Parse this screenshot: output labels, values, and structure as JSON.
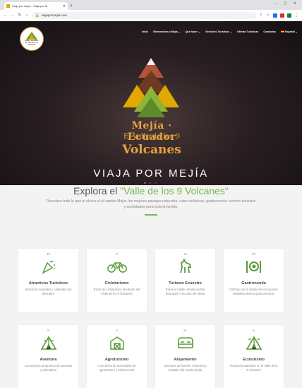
{
  "browser": {
    "tab_title": "Viaja por mejía - Viaja por M",
    "url": "viajapormejia.com"
  },
  "logo": {
    "line1": "Mejía · Ecuador",
    "line2": "El valle de los 9",
    "line3": "Volcanes"
  },
  "nav": {
    "items": [
      "Inicio",
      "Bienvenidos a Mejía ⌄",
      "Qué hacer ⌄",
      "Servicios Turísticos ⌄",
      "Ofertas Turísticas",
      "Contactos",
      "Español ⌄"
    ]
  },
  "hero": {
    "brand_line1": "Mejía · Ecuador",
    "brand_line2": "El valle de los 9",
    "brand_line3": "Volcanes",
    "slogan": "VIAJA POR MEJÍA"
  },
  "explore": {
    "title_prefix": "Explora el ",
    "title_highlight": "\"Valle de los 9 Volcanes\"",
    "subtitle": "Descubre todo lo que te ofrece el el cantón Mejía: los mejores paisajes naturales, rutas ciclísticas, gastronomía, turismo ecuestre y actividades para toda la familia."
  },
  "cards": [
    {
      "count": "40",
      "title": "Atractivos Turísticos",
      "desc": "Atractivos naturales y culturales por descubrir",
      "icon": "party-icon"
    },
    {
      "count": "3",
      "title": "Cicloturismo",
      "desc": "Rutas de cicloturismo alrededor del \"Valle de los 9 Volcanes\"",
      "icon": "bicycle-icon"
    },
    {
      "count": "14",
      "title": "Turismo Ecuestre",
      "desc": "Rutas a caballo donde podrás descubrir el encanto de Mejía",
      "icon": "horse-icon"
    },
    {
      "count": "22",
      "title": "Gastronomía",
      "desc": "Disfruta con tu familia de los mejores establecimientos gastronómicos",
      "icon": "dining-icon"
    },
    {
      "count": "8",
      "title": "Aventura",
      "desc": "Los mejores programas de aventura y adrenalina",
      "icon": "camping-icon"
    },
    {
      "count": "4",
      "title": "Agroturismo",
      "desc": "A opciones de actividades de agroturismo y turismo rural",
      "icon": "farm-icon"
    },
    {
      "count": "21",
      "title": "Alojamiento",
      "desc": "Opciones de hoteles, hosterías y hostales del cantón Mejía",
      "icon": "bed-icon"
    },
    {
      "count": "5",
      "title": "Ecoturismo",
      "desc": "Atractivos Naturales en el Valle de lo 9 Volcanes",
      "icon": "tent-icon"
    }
  ],
  "colors": {
    "accent": "#79b84f",
    "brand_orange": "#e8a33a"
  }
}
